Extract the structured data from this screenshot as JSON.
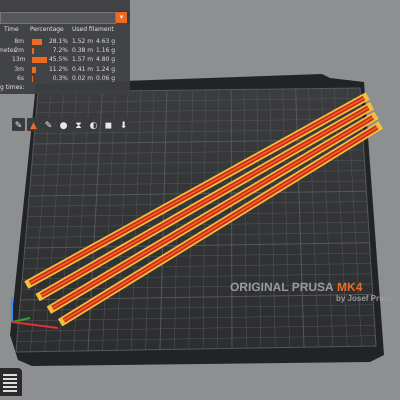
{
  "legend": {
    "columns": [
      "Time",
      "Percentage",
      "Used filament"
    ],
    "rows": [
      {
        "label": "",
        "time": "8m",
        "percent": "28.1%",
        "length": "1.52 m",
        "weight": "4.63 g",
        "fraction": 0.28
      },
      {
        "label": "meter",
        "time": "2m",
        "percent": "7.2%",
        "length": "0.38 m",
        "weight": "1.16 g",
        "fraction": 0.07
      },
      {
        "label": "",
        "time": "13m",
        "percent": "45.5%",
        "length": "1.57 m",
        "weight": "4.80 g",
        "fraction": 0.45
      },
      {
        "label": "",
        "time": "3m",
        "percent": "11.2%",
        "length": "0.41 m",
        "weight": "1.24 g",
        "fraction": 0.11
      },
      {
        "label": "",
        "time": "6s",
        "percent": "0.3%",
        "length": "0.02 m",
        "weight": "0.06 g",
        "fraction": 0.003
      }
    ],
    "footer": "g times:",
    "dropdown_icon": "chevron-down-icon"
  },
  "bed": {
    "brand_line1": "ORIGINAL PRUSA",
    "brand_model": "MK4",
    "brand_line2": "by Josef Prusa",
    "accent_color": "#ed6b21",
    "strip_count": 4
  },
  "toolbar": {
    "icons": [
      "paint-supports-icon",
      "fdm-supports-icon",
      "seam-paint-icon",
      "color-paint-icon",
      "variable-height-icon",
      "hollow-icon",
      "cut-icon",
      "move-icon"
    ]
  },
  "view": {
    "icon": "layers-stack-icon"
  }
}
